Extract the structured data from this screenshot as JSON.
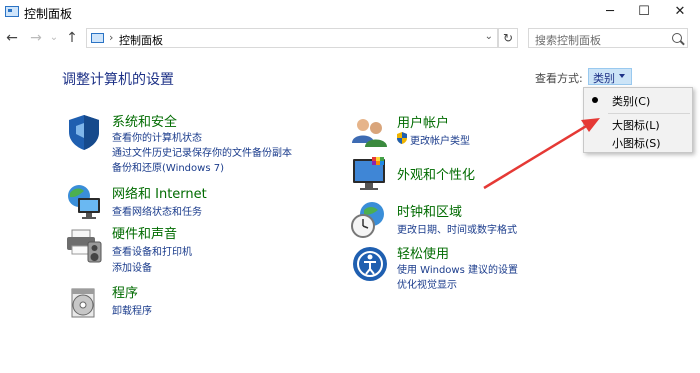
{
  "window": {
    "title": "控制面板",
    "minimize_glyph": "─",
    "maximize_glyph": "☐",
    "close_glyph": "✕"
  },
  "nav": {
    "back_glyph": "←",
    "forward_glyph": "→",
    "history_glyph": "⌄",
    "up_glyph": "↑"
  },
  "address": {
    "separator": "›",
    "path": "控制面板",
    "dropdown_glyph": "⌄",
    "refresh_glyph": "↻"
  },
  "search": {
    "placeholder": "搜索控制面板"
  },
  "main": {
    "heading": "调整计算机的设置"
  },
  "view_by": {
    "label": "查看方式:",
    "selected": "类别",
    "options": [
      {
        "label": "类别(C)",
        "checked": true
      },
      {
        "label": "大图标(L)",
        "checked": false
      },
      {
        "label": "小图标(S)",
        "checked": false
      }
    ]
  },
  "left_categories": [
    {
      "icon": "shield-icon",
      "title": "系统和安全",
      "links": [
        "查看你的计算机状态",
        "通过文件历史记录保存你的文件备份副本",
        "备份和还原(Windows 7)"
      ]
    },
    {
      "icon": "network-globe-icon",
      "title": "网络和 Internet",
      "links": [
        "查看网络状态和任务"
      ]
    },
    {
      "icon": "printer-speaker-icon",
      "title": "硬件和声音",
      "links": [
        "查看设备和打印机",
        "添加设备"
      ]
    },
    {
      "icon": "programs-disc-icon",
      "title": "程序",
      "links": [
        "卸载程序"
      ]
    }
  ],
  "right_categories": [
    {
      "icon": "users-icon",
      "title": "用户帐户",
      "links": [
        "更改帐户类型"
      ]
    },
    {
      "icon": "appearance-monitor-icon",
      "title": "外观和个性化",
      "links": []
    },
    {
      "icon": "clock-globe-icon",
      "title": "时钟和区域",
      "links": [
        "更改日期、时间或数字格式"
      ]
    },
    {
      "icon": "ease-of-access-icon",
      "title": "轻松使用",
      "links": [
        "使用 Windows 建议的设置",
        "优化视觉显示"
      ]
    }
  ],
  "colors": {
    "heading": "#1e3287",
    "category_title": "#006b00",
    "link": "#1b3c8c",
    "annotation_arrow": "#e53935"
  }
}
